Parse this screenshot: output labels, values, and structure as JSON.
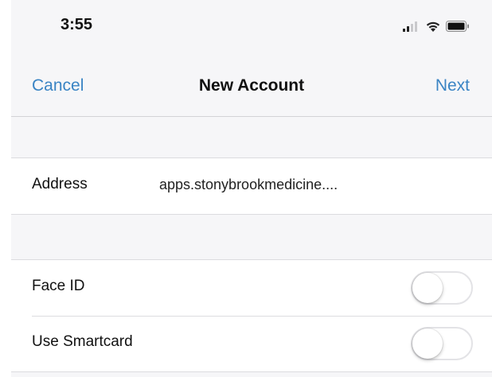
{
  "status_bar": {
    "time": "3:55",
    "icons": [
      "cellular-signal-icon",
      "wifi-icon",
      "battery-icon"
    ]
  },
  "nav": {
    "cancel_label": "Cancel",
    "title": "New Account",
    "next_label": "Next"
  },
  "account": {
    "address_label": "Address",
    "address_value": "apps.stonybrookmedicine...."
  },
  "options": {
    "face_id_label": "Face ID",
    "face_id_enabled": false,
    "smartcard_label": "Use Smartcard",
    "smartcard_enabled": false
  },
  "colors": {
    "accent": "#3a84c4",
    "background": "#f6f6f8"
  }
}
